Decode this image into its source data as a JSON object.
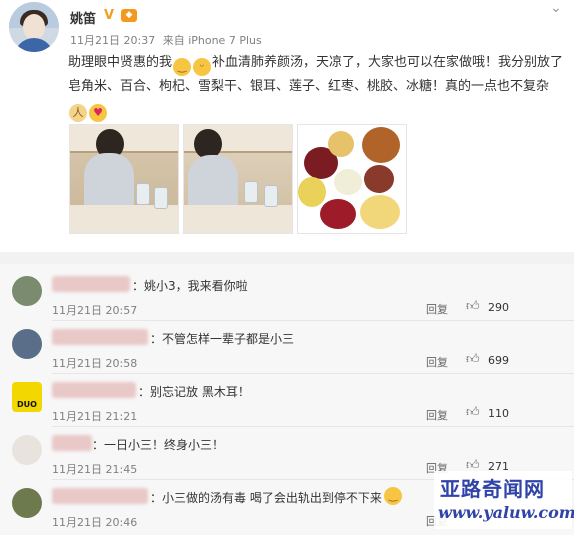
{
  "post": {
    "author": "姚笛",
    "verified_icon": "verified-v-icon",
    "vip_icon": "vip-badge-icon",
    "date": "11月21日 20:37",
    "source": "来自 iPhone 7 Plus",
    "text_part1": "助理眼中贤惠的我",
    "text_part2": "补血清肺养颜汤，天凉了，大家也可以在家做哦！我分别放了皂角米、百合、枸杞、雪梨干、银耳、莲子、红枣、桃胶、冰糖！真的一点也不复杂",
    "photos": [
      "photo-1",
      "photo-2",
      "photo-3"
    ]
  },
  "comments": [
    {
      "text": "：姚小3，我来看你啦",
      "time": "11月21日 20:57",
      "reply": "回复",
      "likes": "290"
    },
    {
      "text": "：不管怎样一辈子都是小三",
      "time": "11月21日 20:58",
      "reply": "回复",
      "likes": "699"
    },
    {
      "text": "：别忘记放 黑木耳！",
      "time": "11月21日 21:21",
      "reply": "回复",
      "likes": "110"
    },
    {
      "text": "：一日小三！终身小三！",
      "time": "11月21日 21:45",
      "reply": "回复",
      "likes": "271"
    },
    {
      "text": "：小三做的汤有毒  喝了会出轨出到停不下来",
      "time": "11月21日 20:46",
      "reply": "回复",
      "likes": ""
    }
  ],
  "avatar_labels": {
    "duo": "DUO"
  },
  "watermark": {
    "title": "亚路奇闻网",
    "url": "www.yaluw.com"
  },
  "colors": {
    "accent": "#f39a1e",
    "watermark": "#2f43a8"
  }
}
